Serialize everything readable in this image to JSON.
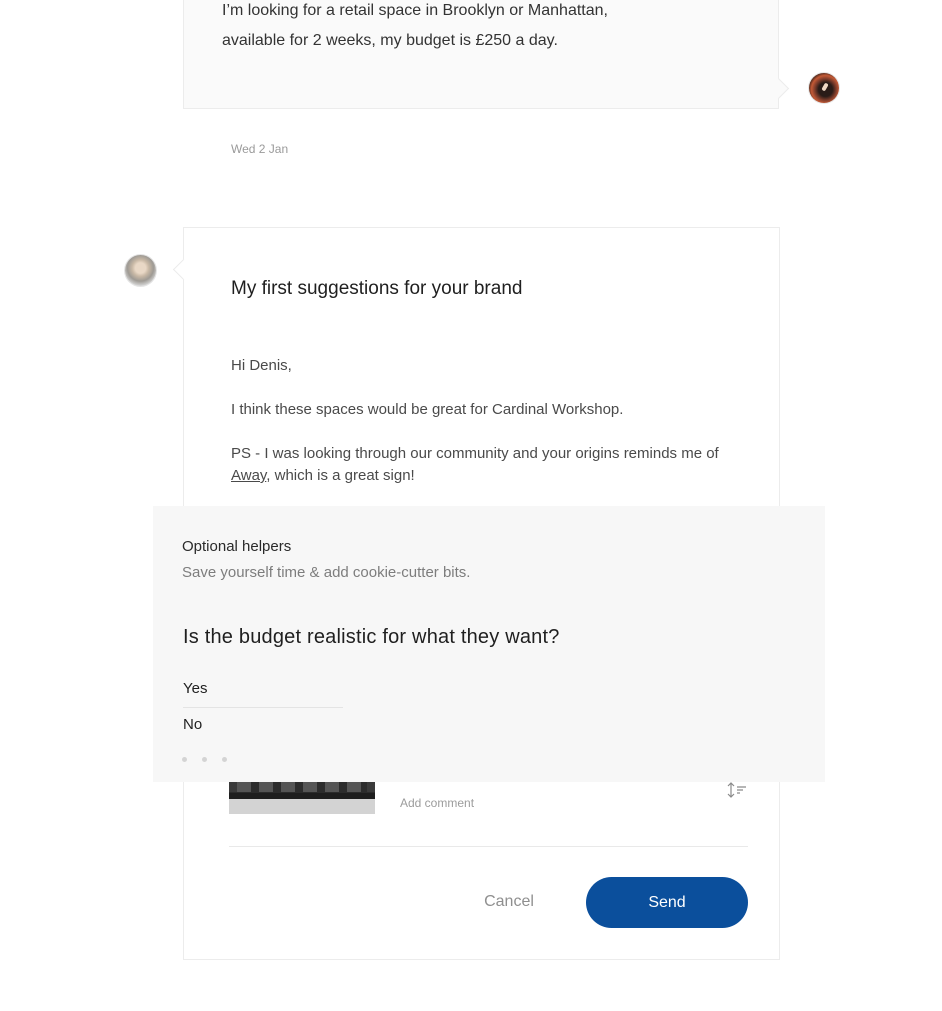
{
  "user_message": {
    "line1": "I’m looking for a retail space in Brooklyn or Manhattan,",
    "line2": "available for 2 weeks, my budget is £250 a day.",
    "avatar_icon": "user-avatar-icon"
  },
  "date": "Wed 2 Jan",
  "card": {
    "title": "My first suggestions for your brand",
    "greeting": "Hi Denis,",
    "body": "I think these spaces would be great for Cardinal Workshop.",
    "ps_before": "PS - I was looking through our community and your origins reminds me of ",
    "ps_link": "Away",
    "ps_after": ", which is a great sign!",
    "add_comment": "Add comment",
    "cancel_label": "Cancel",
    "send_label": "Send",
    "send_color": "#0b4f9c"
  },
  "helpers": {
    "title": "Optional helpers",
    "subtitle": "Save yourself time & add cookie-cutter bits.",
    "question": "Is the budget realistic for what they want?",
    "options": [
      "Yes",
      "No"
    ]
  }
}
